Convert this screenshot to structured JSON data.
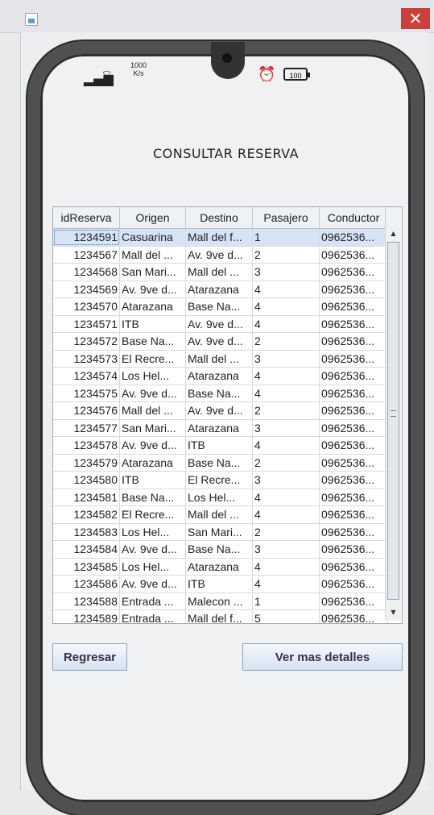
{
  "window": {
    "close_label": "✕"
  },
  "status_bar": {
    "speed_value": "1000",
    "speed_unit": "K/s",
    "battery": "100"
  },
  "page_title": "CONSULTAR RESERVA",
  "table": {
    "headers": [
      "idReserva",
      "Origen",
      "Destino",
      "Pasajero",
      "Conductor"
    ],
    "selected_row": 0,
    "rows": [
      [
        "1234591",
        "Casuarina",
        "Mall del f...",
        "1",
        "0962536..."
      ],
      [
        "1234567",
        "Mall del ...",
        "Av. 9ve d...",
        "2",
        "0962536..."
      ],
      [
        "1234568",
        "San Mari...",
        "Mall del ...",
        "3",
        "0962536..."
      ],
      [
        "1234569",
        "Av. 9ve d...",
        "Atarazana",
        "4",
        "0962536..."
      ],
      [
        "1234570",
        "Atarazana",
        "Base Na...",
        "4",
        "0962536..."
      ],
      [
        "1234571",
        "ITB",
        "Av. 9ve d...",
        "4",
        "0962536..."
      ],
      [
        "1234572",
        "Base Na...",
        "Av. 9ve d...",
        "2",
        "0962536..."
      ],
      [
        "1234573",
        "El Recre...",
        "Mall del ...",
        "3",
        "0962536..."
      ],
      [
        "1234574",
        "Los Hel...",
        "Atarazana",
        "4",
        "0962536..."
      ],
      [
        "1234575",
        "Av. 9ve d...",
        "Base Na...",
        "4",
        "0962536..."
      ],
      [
        "1234576",
        "Mall del ...",
        "Av. 9ve d...",
        "2",
        "0962536..."
      ],
      [
        "1234577",
        "San Mari...",
        "Atarazana",
        "3",
        "0962536..."
      ],
      [
        "1234578",
        "Av. 9ve d...",
        "ITB",
        "4",
        "0962536..."
      ],
      [
        "1234579",
        "Atarazana",
        "Base Na...",
        "2",
        "0962536..."
      ],
      [
        "1234580",
        "ITB",
        "El Recre...",
        "3",
        "0962536..."
      ],
      [
        "1234581",
        "Base Na...",
        "Los Hel...",
        "4",
        "0962536..."
      ],
      [
        "1234582",
        "El Recre...",
        "Mall del ...",
        "4",
        "0962536..."
      ],
      [
        "1234583",
        "Los Hel...",
        "San Mari...",
        "2",
        "0962536..."
      ],
      [
        "1234584",
        "Av. 9ve d...",
        "Base Na...",
        "3",
        "0962536..."
      ],
      [
        "1234585",
        "Los Hel...",
        "Atarazana",
        "4",
        "0962536..."
      ],
      [
        "1234586",
        "Av. 9ve d...",
        "ITB",
        "4",
        "0962536..."
      ],
      [
        "1234588",
        "Entrada ...",
        "Malecon ...",
        "1",
        "0962536..."
      ],
      [
        "1234589",
        "Entrada ...",
        "Mall del f...",
        "5",
        "0962536..."
      ]
    ]
  },
  "buttons": {
    "back": "Regresar",
    "details": "Ver mas detalles"
  }
}
